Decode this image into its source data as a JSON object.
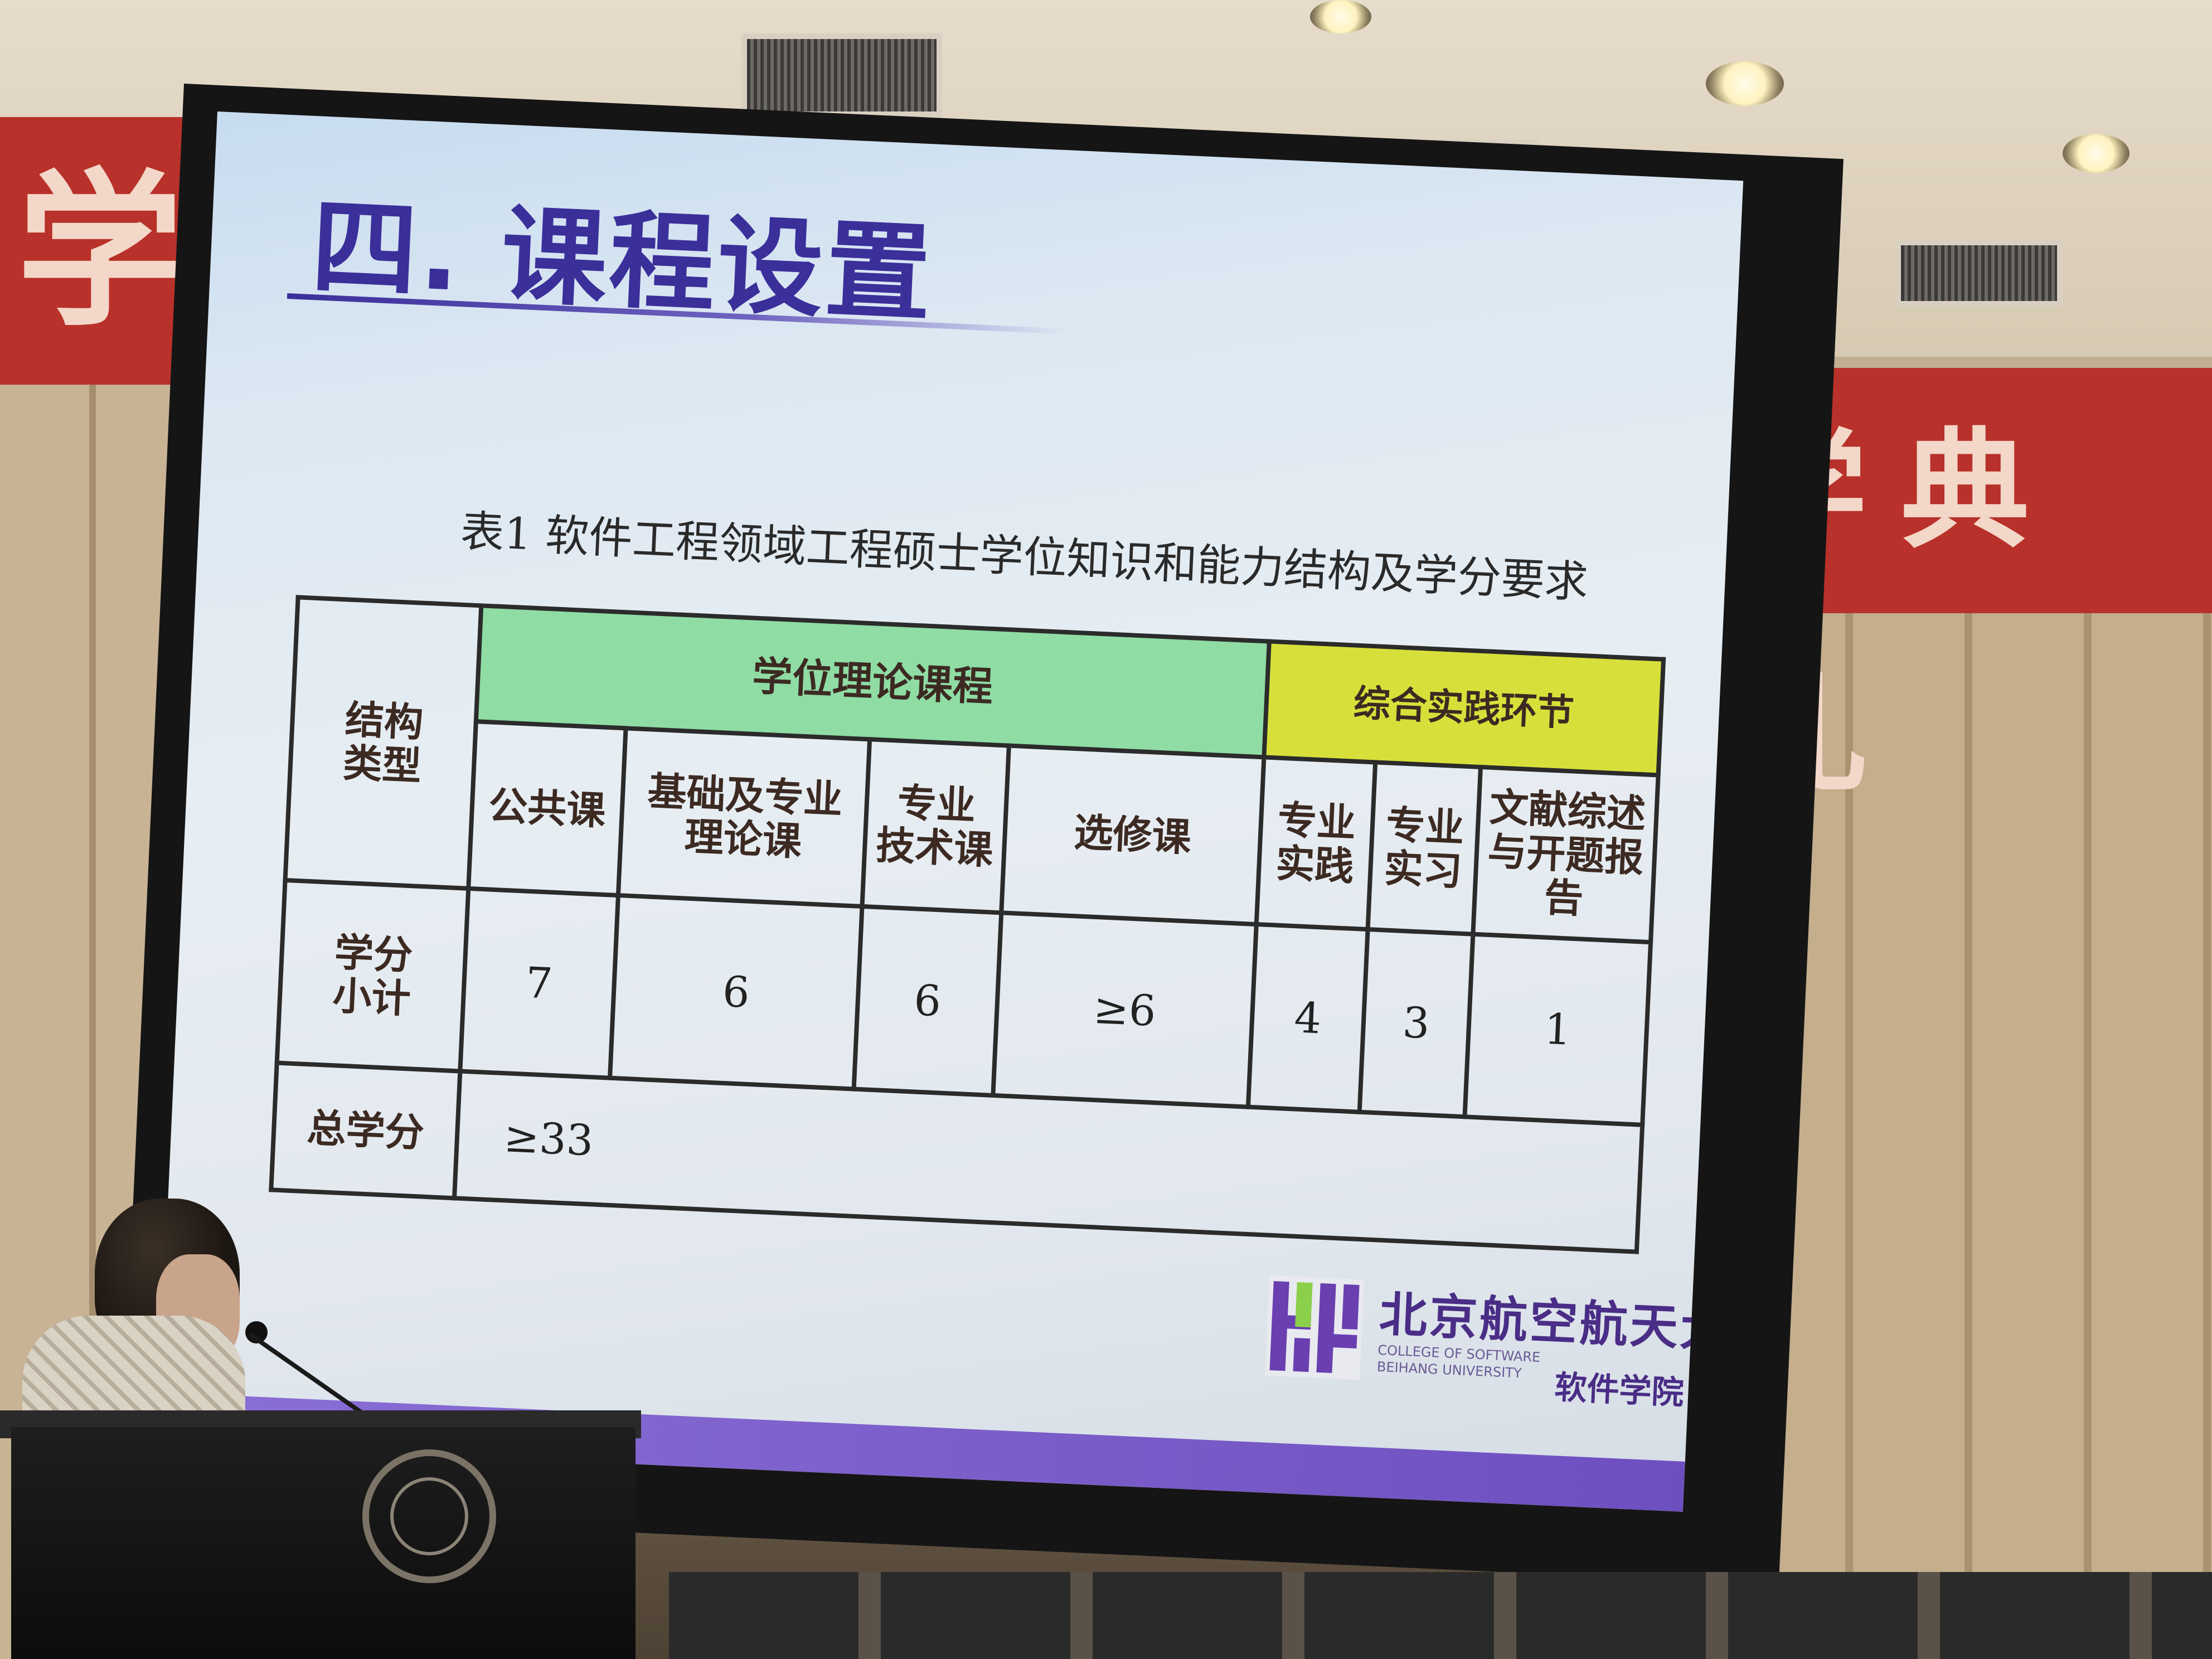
{
  "slide": {
    "title": "四. 课程设置",
    "caption": "表1  软件工程领域工程硕士学位知识和能力结构及学分要求",
    "table": {
      "structure_type_label": "结构\n类型",
      "group_theory": "学位理论课程",
      "group_practice": "综合实践环节",
      "columns": [
        "公共课",
        "基础及专业\n理论课",
        "专业\n技术课",
        "选修课",
        "专业\n实践",
        "专业\n实习",
        "文献综述\n与开题报告"
      ],
      "credit_subtotal_label": "学分\n小计",
      "credit_subtotals": [
        "7",
        "6",
        "6",
        "≥6",
        "4",
        "3",
        "1"
      ],
      "total_credit_label": "总学分",
      "total_credit_value": "≥33"
    },
    "logo": {
      "university_cn": "北京航空航天大學",
      "college_en": "COLLEGE OF SOFTWARE\nBEIHANG UNIVERSITY",
      "college_cn": "软件学院"
    },
    "colors": {
      "title": "#3b2f9a",
      "header_green": "#8fdca4",
      "header_yellow": "#d7e03a",
      "footer_bar": "#7a5cc9"
    }
  },
  "room": {
    "banner_left": "学",
    "banner_right": "学典礼"
  }
}
